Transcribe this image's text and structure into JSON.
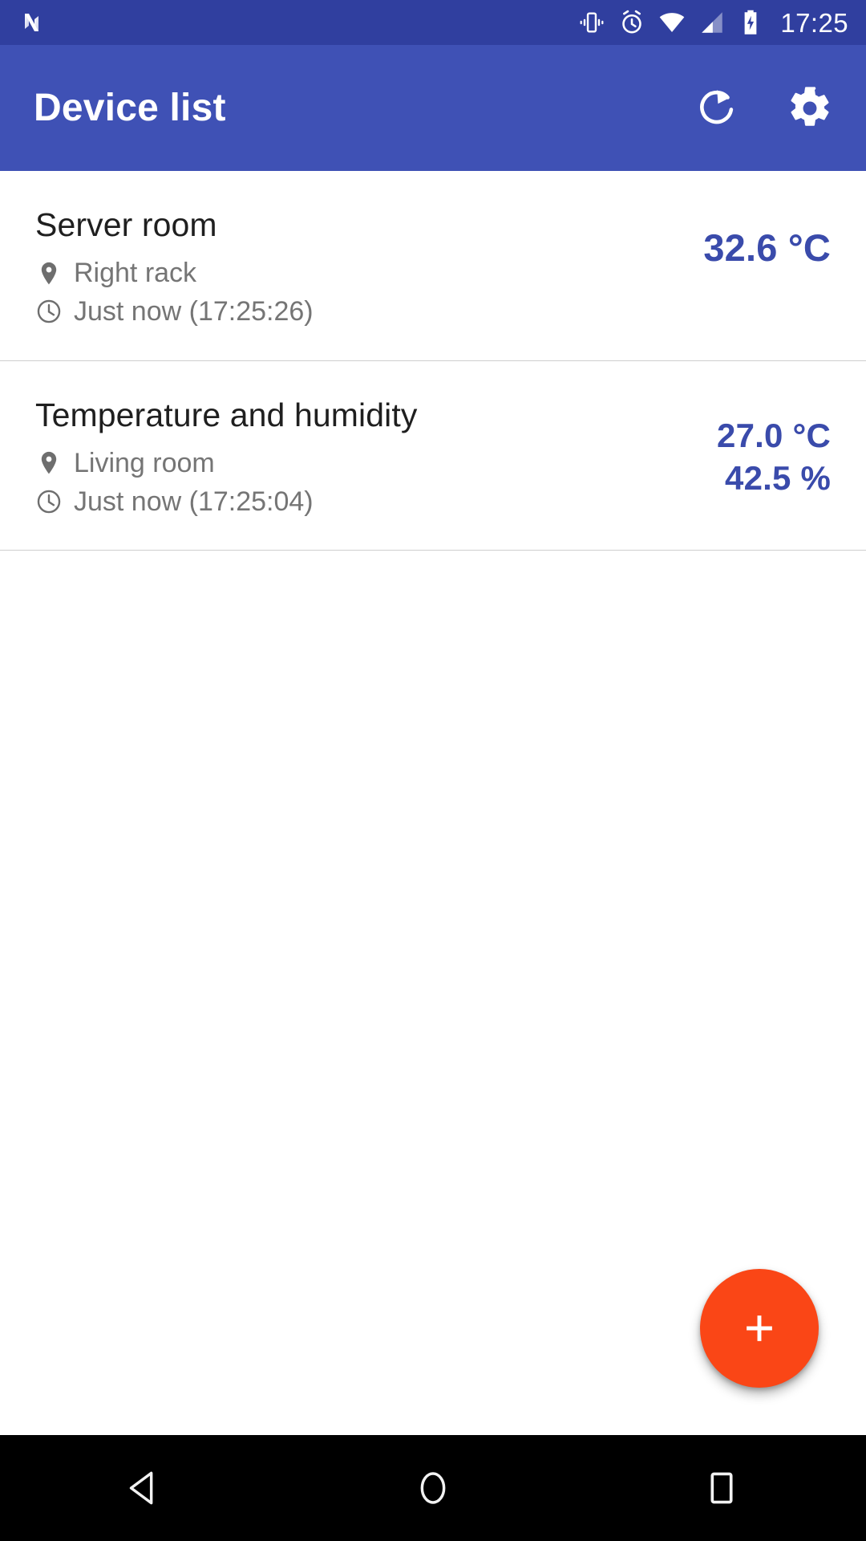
{
  "status_bar": {
    "os_logo_icon": "android-nougat-logo",
    "icons": [
      "vibrate-icon",
      "alarm-clock-icon",
      "wifi-icon",
      "cellular-signal-icon",
      "battery-charging-icon"
    ],
    "clock": "17:25",
    "background_color": "#303F9F"
  },
  "app_bar": {
    "title": "Device list",
    "background_color": "#3F51B5",
    "actions": [
      {
        "name": "refresh",
        "icon": "refresh-icon"
      },
      {
        "name": "settings",
        "icon": "gear-icon"
      }
    ]
  },
  "devices": [
    {
      "name": "Server room",
      "location": "Right rack",
      "location_icon": "location-pin-icon",
      "timestamp": "Just now (17:25:26)",
      "timestamp_icon": "clock-icon",
      "primary_value": "32.6 °C",
      "secondary_value": "",
      "value_color": "#3a4bab"
    },
    {
      "name": "Temperature and humidity",
      "location": "Living room",
      "location_icon": "location-pin-icon",
      "timestamp": "Just now (17:25:04)",
      "timestamp_icon": "clock-icon",
      "primary_value": "27.0 °C",
      "secondary_value": "42.5 %",
      "value_color": "#3a4bab"
    }
  ],
  "fab": {
    "label": "+",
    "icon": "plus-icon",
    "background_color": "#FA4616"
  },
  "nav_bar": {
    "background_color": "#000000",
    "buttons": [
      {
        "name": "back",
        "icon": "back-triangle-icon"
      },
      {
        "name": "home",
        "icon": "home-circle-icon"
      },
      {
        "name": "recents",
        "icon": "recents-square-icon"
      }
    ]
  }
}
